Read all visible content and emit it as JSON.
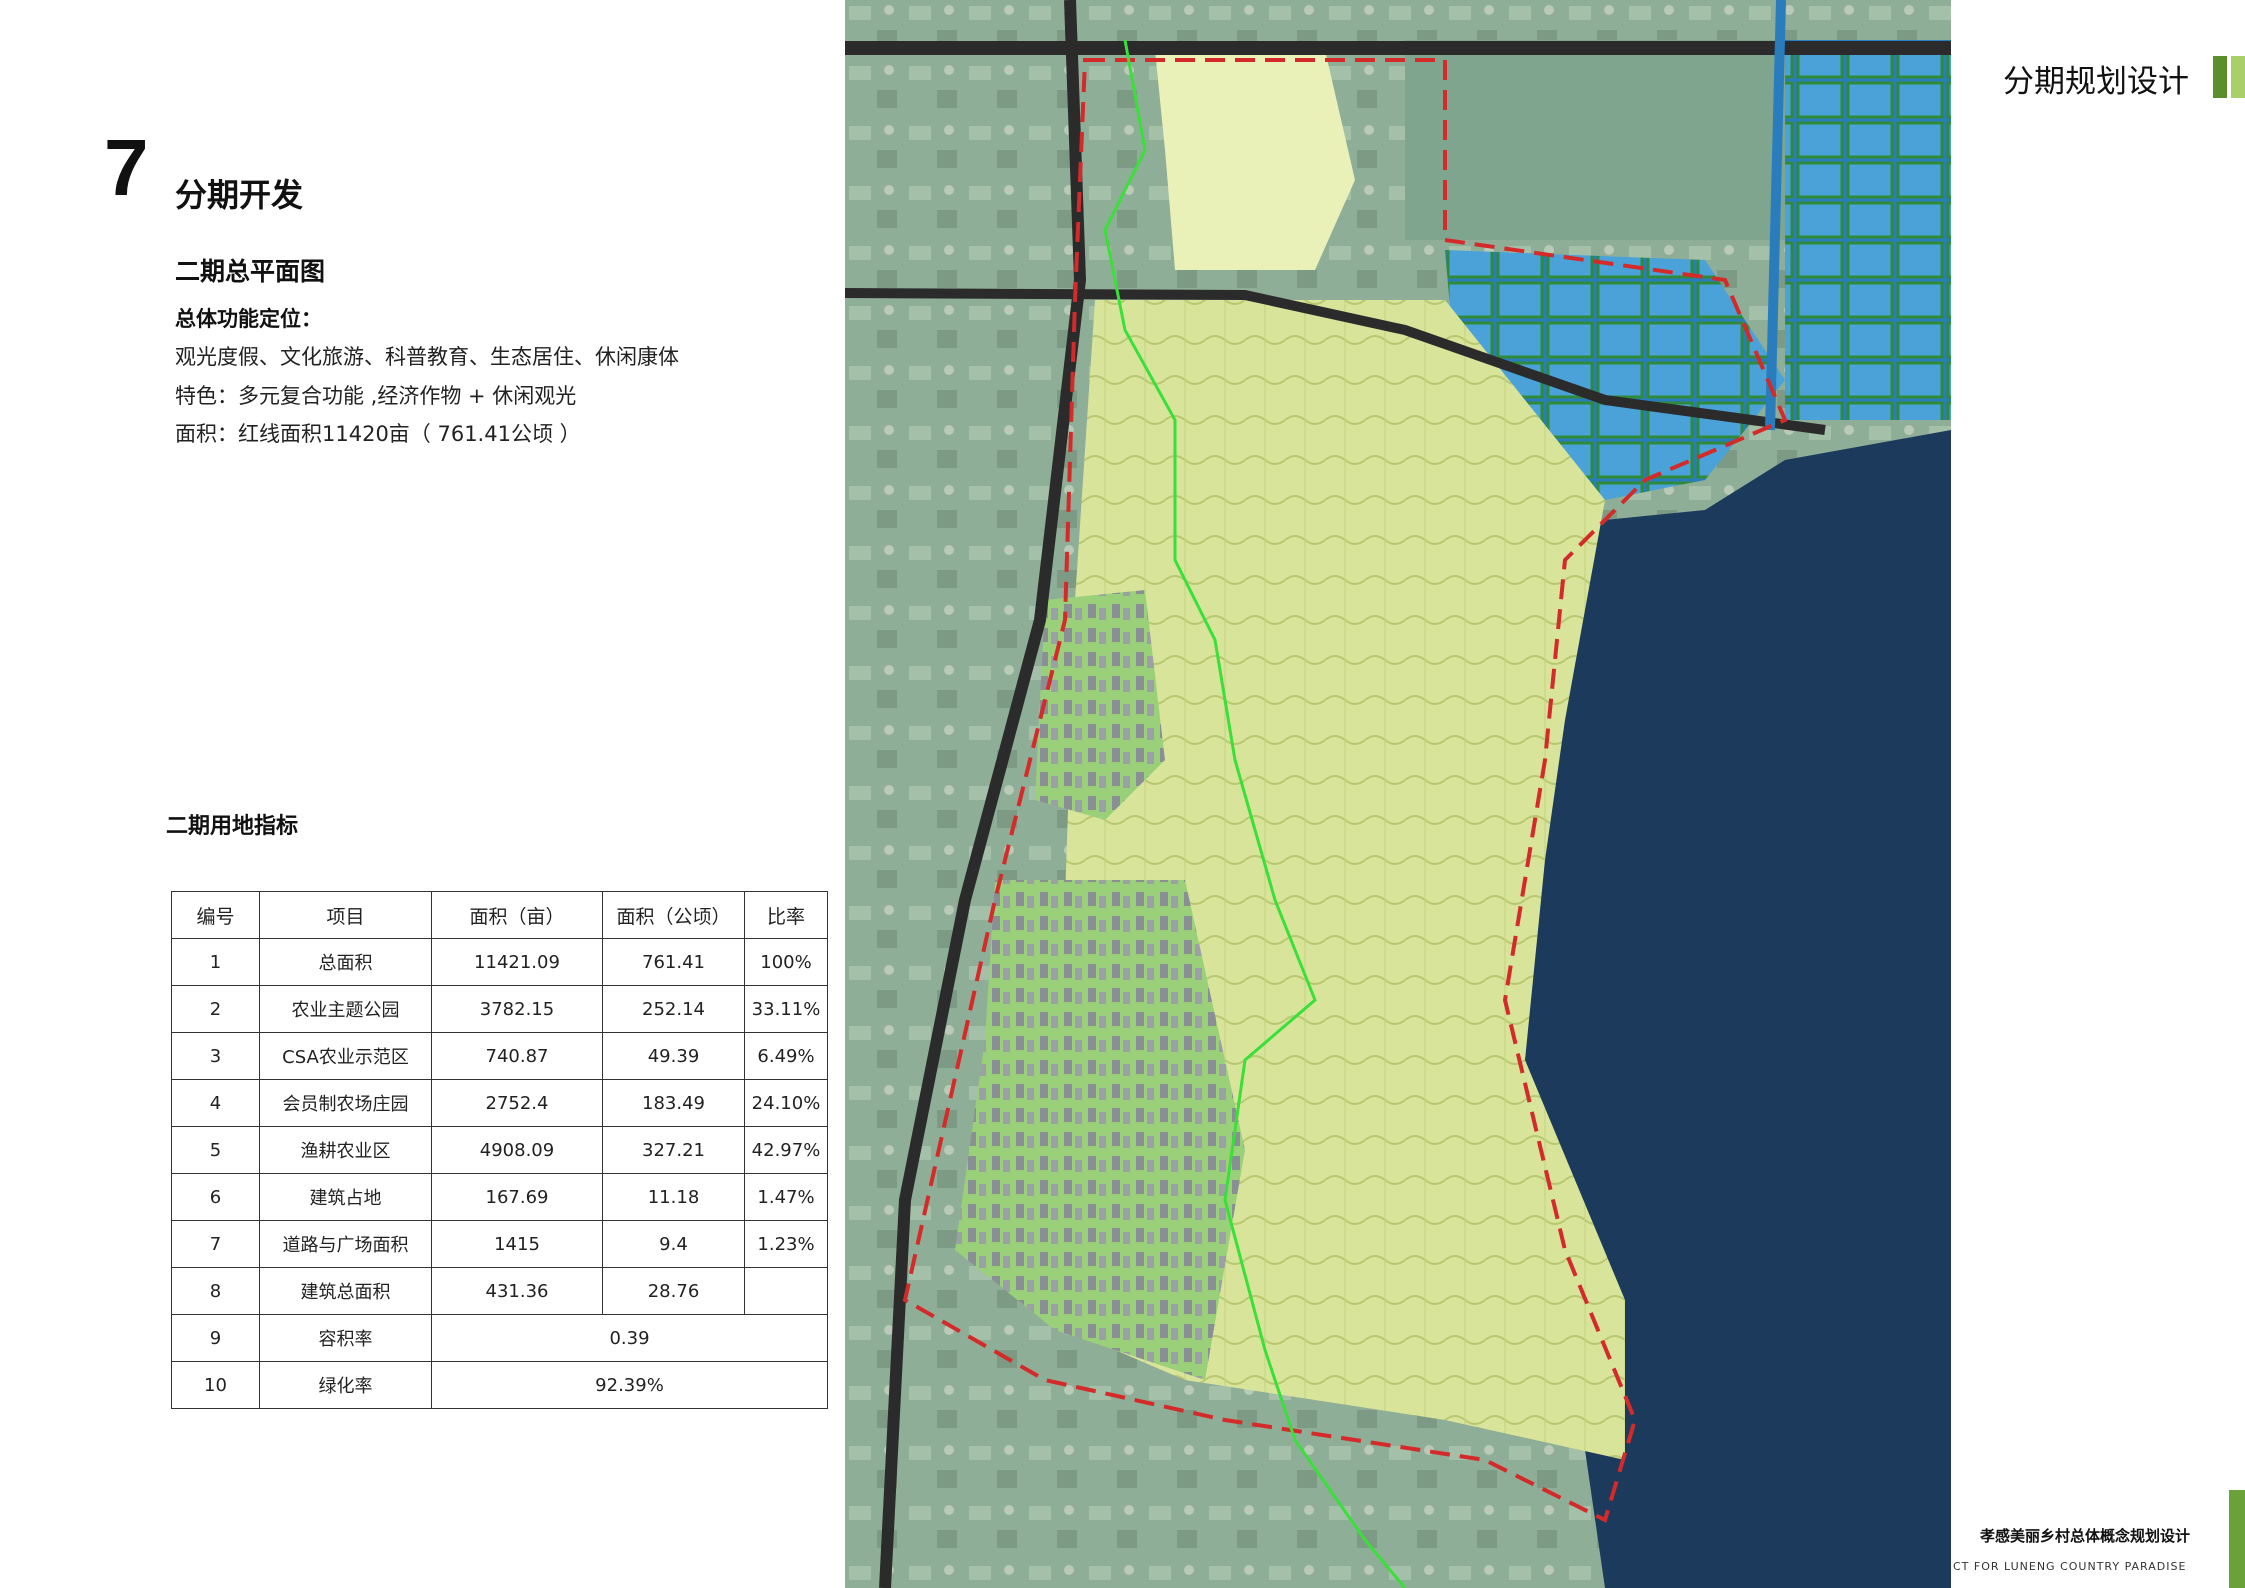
{
  "section": {
    "number": "7",
    "title": "分期开发"
  },
  "subtitle": "二期总平面图",
  "function_label": "总体功能定位：",
  "info_lines": [
    "观光度假、文化旅游、科普教育、生态居住、休闲康体",
    "特色：多元复合功能 ,经济作物 + 休闲观光",
    "面积：红线面积11420亩（ 761.41公顷 ）"
  ],
  "table_title": "二期用地指标",
  "table": {
    "headers": [
      "编号",
      "项目",
      "面积（亩）",
      "面积（公顷）",
      "比率"
    ],
    "rows": [
      [
        "1",
        "总面积",
        "11421.09",
        "761.41",
        "100%"
      ],
      [
        "2",
        "农业主题公园",
        "3782.15",
        "252.14",
        "33.11%"
      ],
      [
        "3",
        "CSA农业示范区",
        "740.87",
        "49.39",
        "6.49%"
      ],
      [
        "4",
        "会员制农场庄园",
        "2752.4",
        "183.49",
        "24.10%"
      ],
      [
        "5",
        "渔耕农业区",
        "4908.09",
        "327.21",
        "42.97%"
      ],
      [
        "6",
        "建筑占地",
        "167.69",
        "11.18",
        "1.47%"
      ],
      [
        "7",
        "道路与广场面积",
        "1415",
        "9.4",
        "1.23%"
      ],
      [
        "8",
        "建筑总面积",
        "431.36",
        "28.76",
        ""
      ]
    ],
    "merged_rows": [
      [
        "9",
        "容积率",
        "0.39"
      ],
      [
        "10",
        "绿化率",
        "92.39%"
      ]
    ]
  },
  "header_title": "分期规划设计",
  "footer": {
    "title": "孝感美丽乡村总体概念规划设计",
    "subtitle": "CT FOR LUNENG COUNTRY PARADISE"
  },
  "colors": {
    "accent_dark": "#5b8f2c",
    "accent_light": "#a9cf6a",
    "lake": "#1b3a5c",
    "boundary_red": "#d42a2a",
    "boundary_green": "#39e039"
  }
}
